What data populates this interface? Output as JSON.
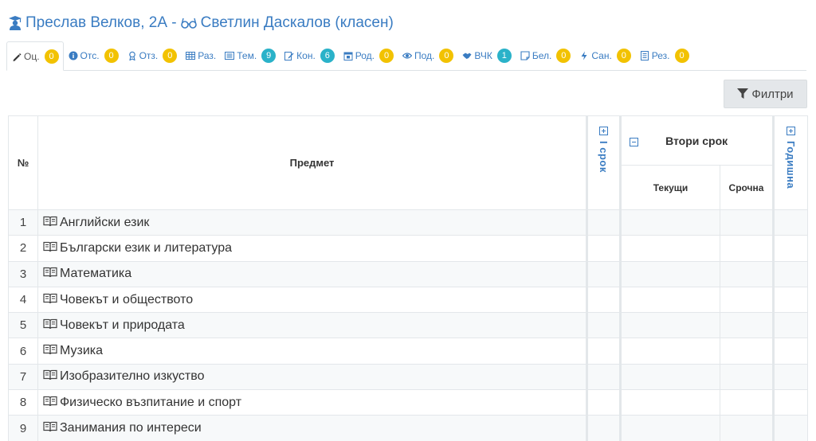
{
  "header": {
    "title": "Преслав Велков, 2А - ",
    "teacher": "Светлин Даскалов (класен)"
  },
  "tabs": [
    {
      "label": "Оц.",
      "count": "0",
      "badge_color": "#f2c200",
      "icon": "pencil-icon"
    },
    {
      "label": "Отс.",
      "count": "0",
      "badge_color": "#f2c200",
      "icon": "info-icon"
    },
    {
      "label": "Отз.",
      "count": "0",
      "badge_color": "#f2c200",
      "icon": "award-icon"
    },
    {
      "label": "Раз.",
      "count": "",
      "badge_color": "",
      "icon": "table-icon"
    },
    {
      "label": "Тем.",
      "count": "9",
      "badge_color": "#2ab2c9",
      "icon": "list-icon"
    },
    {
      "label": "Кон.",
      "count": "6",
      "badge_color": "#2ab2c9",
      "icon": "edit-doc-icon"
    },
    {
      "label": "Род.",
      "count": "0",
      "badge_color": "#f2c200",
      "icon": "calendar-icon"
    },
    {
      "label": "Под.",
      "count": "0",
      "badge_color": "#f2c200",
      "icon": "eye-icon"
    },
    {
      "label": "ВЧК",
      "count": "1",
      "badge_color": "#2ab2c9",
      "icon": "handshake-icon"
    },
    {
      "label": "Бел.",
      "count": "0",
      "badge_color": "#f2c200",
      "icon": "note-icon"
    },
    {
      "label": "Сан.",
      "count": "0",
      "badge_color": "#f2c200",
      "icon": "bolt-icon"
    },
    {
      "label": "Рез.",
      "count": "0",
      "badge_color": "#f2c200",
      "icon": "doc-list-icon"
    }
  ],
  "filter_button": {
    "label": "Филтри",
    "icon": "filter-icon"
  },
  "table": {
    "col_no": "№",
    "col_subject": "Предмет",
    "term1": "I срок",
    "term2": "Втори срок",
    "current": "Текущи",
    "final": "Срочна",
    "annual": "Годишна",
    "rows": [
      {
        "no": "1",
        "subject": "Английски език"
      },
      {
        "no": "2",
        "subject": "Български език и литература"
      },
      {
        "no": "3",
        "subject": "Математика"
      },
      {
        "no": "4",
        "subject": "Човекът и обществото"
      },
      {
        "no": "5",
        "subject": "Човекът и природата"
      },
      {
        "no": "6",
        "subject": "Музика"
      },
      {
        "no": "7",
        "subject": "Изобразително изкуство"
      },
      {
        "no": "8",
        "subject": "Физическо възпитание и спорт"
      },
      {
        "no": "9",
        "subject": "Занимания по интереси"
      }
    ]
  },
  "colors": {
    "accent": "#3a7cc2",
    "yellow_badge": "#f2c200",
    "teal_badge": "#2ab2c9"
  }
}
